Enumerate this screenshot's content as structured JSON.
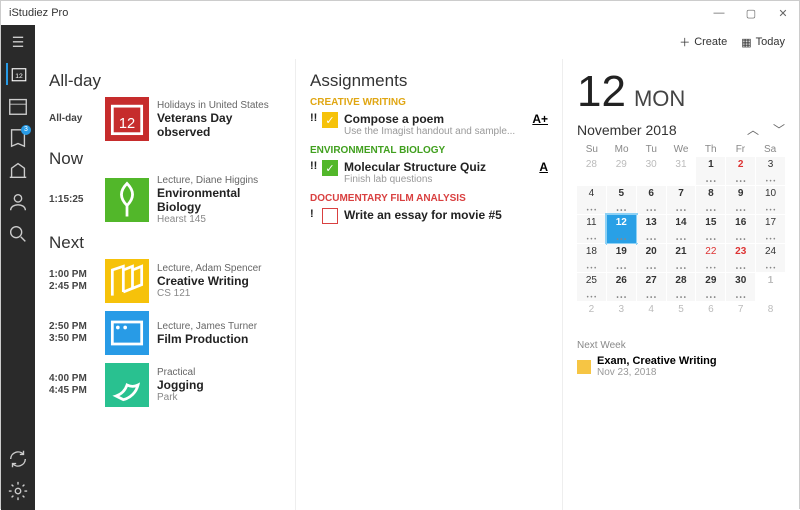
{
  "window": {
    "title": "iStudiez Pro"
  },
  "toolbar": {
    "create": "Create",
    "today": "Today"
  },
  "sidebar": {
    "badge": "3"
  },
  "sections": {
    "allday": "All-day",
    "now": "Now",
    "next": "Next",
    "assignments": "Assignments"
  },
  "events": {
    "allday": {
      "time": "All-day",
      "sub": "Holidays in United States",
      "title": "Veterans Day observed",
      "icon_day": "12"
    },
    "now": {
      "time": "1:15:25",
      "sub": "Lecture, Diane Higgins",
      "title": "Environmental Biology",
      "loc": "Hearst 145"
    },
    "next": [
      {
        "t1": "1:00 PM",
        "t2": "2:45 PM",
        "sub": "Lecture, Adam Spencer",
        "title": "Creative Writing",
        "loc": "CS 121",
        "color": "#f6c20a"
      },
      {
        "t1": "2:50 PM",
        "t2": "3:50 PM",
        "sub": "Lecture, James Turner",
        "title": "Film Production",
        "loc": "",
        "color": "#289be6"
      },
      {
        "t1": "4:00 PM",
        "t2": "4:45 PM",
        "sub": "Practical",
        "title": "Jogging",
        "loc": "Park",
        "color": "#29c190"
      }
    ]
  },
  "assignments": [
    {
      "cat": "CREATIVE WRITING",
      "catColor": "#e0a612",
      "pri": "!!",
      "checked": true,
      "cbColor": "#f6c20a",
      "title": "Compose a poem",
      "sub": "Use the Imagist handout and sample...",
      "grade": "A+"
    },
    {
      "cat": "ENVIRONMENTAL BIOLOGY",
      "catColor": "#41a01f",
      "pri": "!!",
      "checked": true,
      "cbColor": "#52b72a",
      "title": "Molecular Structure Quiz",
      "sub": "Finish lab questions",
      "grade": "A"
    },
    {
      "cat": "DOCUMENTARY FILM ANALYSIS",
      "catColor": "#d94040",
      "pri": "!",
      "checked": false,
      "cbColor": "#d94040",
      "title": "Write an essay for movie #5",
      "sub": "",
      "grade": ""
    }
  ],
  "date": {
    "num": "12",
    "name": "MON",
    "month": "November 2018"
  },
  "calendar": {
    "dow": [
      "Su",
      "Mo",
      "Tu",
      "We",
      "Th",
      "Fr",
      "Sa"
    ],
    "weeks": [
      [
        {
          "d": "28",
          "dim": 1
        },
        {
          "d": "29",
          "dim": 1
        },
        {
          "d": "30",
          "dim": 1
        },
        {
          "d": "31",
          "dim": 1
        },
        {
          "d": "1",
          "b": 1
        },
        {
          "d": "2",
          "b": 1,
          "red": 1
        },
        {
          "d": "3"
        }
      ],
      [
        {
          "d": "4"
        },
        {
          "d": "5",
          "b": 1
        },
        {
          "d": "6",
          "b": 1
        },
        {
          "d": "7",
          "b": 1
        },
        {
          "d": "8",
          "b": 1
        },
        {
          "d": "9",
          "b": 1
        },
        {
          "d": "10"
        }
      ],
      [
        {
          "d": "11"
        },
        {
          "d": "12",
          "sel": 1
        },
        {
          "d": "13",
          "b": 1
        },
        {
          "d": "14",
          "b": 1
        },
        {
          "d": "15",
          "b": 1
        },
        {
          "d": "16",
          "b": 1
        },
        {
          "d": "17"
        }
      ],
      [
        {
          "d": "18"
        },
        {
          "d": "19",
          "b": 1
        },
        {
          "d": "20",
          "b": 1
        },
        {
          "d": "21",
          "b": 1
        },
        {
          "d": "22",
          "red": 1
        },
        {
          "d": "23",
          "b": 1,
          "red": 1
        },
        {
          "d": "24"
        }
      ],
      [
        {
          "d": "25"
        },
        {
          "d": "26",
          "b": 1
        },
        {
          "d": "27",
          "b": 1
        },
        {
          "d": "28",
          "b": 1
        },
        {
          "d": "29",
          "b": 1
        },
        {
          "d": "30",
          "b": 1
        },
        {
          "d": "1",
          "dim": 1,
          "b": 1
        }
      ],
      [
        {
          "d": "2",
          "dim": 1
        },
        {
          "d": "3",
          "dim": 1
        },
        {
          "d": "4",
          "dim": 1
        },
        {
          "d": "5",
          "dim": 1
        },
        {
          "d": "6",
          "dim": 1
        },
        {
          "d": "7",
          "dim": 1
        },
        {
          "d": "8",
          "dim": 1
        }
      ]
    ]
  },
  "nextWeek": {
    "label": "Next Week",
    "title": "Exam, Creative Writing",
    "date": "Nov 23, 2018"
  }
}
